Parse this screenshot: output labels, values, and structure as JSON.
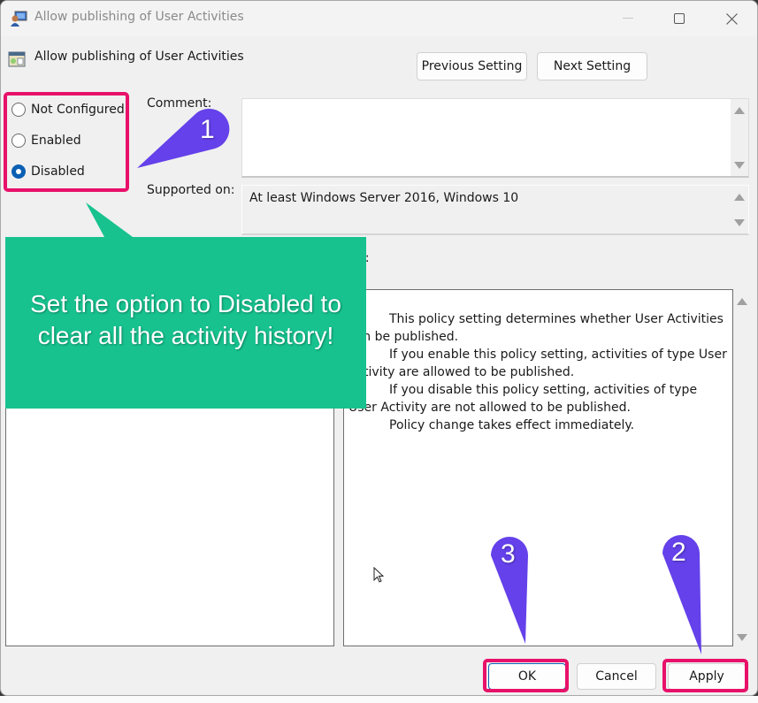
{
  "window": {
    "title": "Allow publishing of User Activities",
    "controls": {
      "minimize": "minimize-icon",
      "maximize": "maximize-icon",
      "close": "close-icon"
    }
  },
  "header": {
    "setting_title": "Allow publishing of User Activities",
    "previous_label": "Previous Setting",
    "next_label": "Next Setting"
  },
  "state_options": [
    {
      "label": "Not Configured",
      "checked": false
    },
    {
      "label": "Enabled",
      "checked": false
    },
    {
      "label": "Disabled",
      "checked": true
    }
  ],
  "comment": {
    "label": "Comment:",
    "value": ""
  },
  "supported_on": {
    "label": "Supported on:",
    "value": "At least Windows Server 2016, Windows 10"
  },
  "help": {
    "label": "Help:",
    "paragraphs": [
      "This policy setting determines whether User Activities can be published.",
      "If you enable this policy setting, activities of type User Activity are allowed to be published.",
      "If you disable this policy setting, activities of type User Activity are not allowed to be published.",
      "Policy change takes effect immediately."
    ]
  },
  "footer": {
    "ok_label": "OK",
    "cancel_label": "Cancel",
    "apply_label": "Apply"
  },
  "annotations": {
    "callout_text": "Set the option to Disabled to clear all the activity history!",
    "markers": [
      "1",
      "2",
      "3"
    ],
    "colors": {
      "callout": "#17c28f",
      "marker": "#6441ea",
      "highlight": "#e8116a"
    }
  }
}
